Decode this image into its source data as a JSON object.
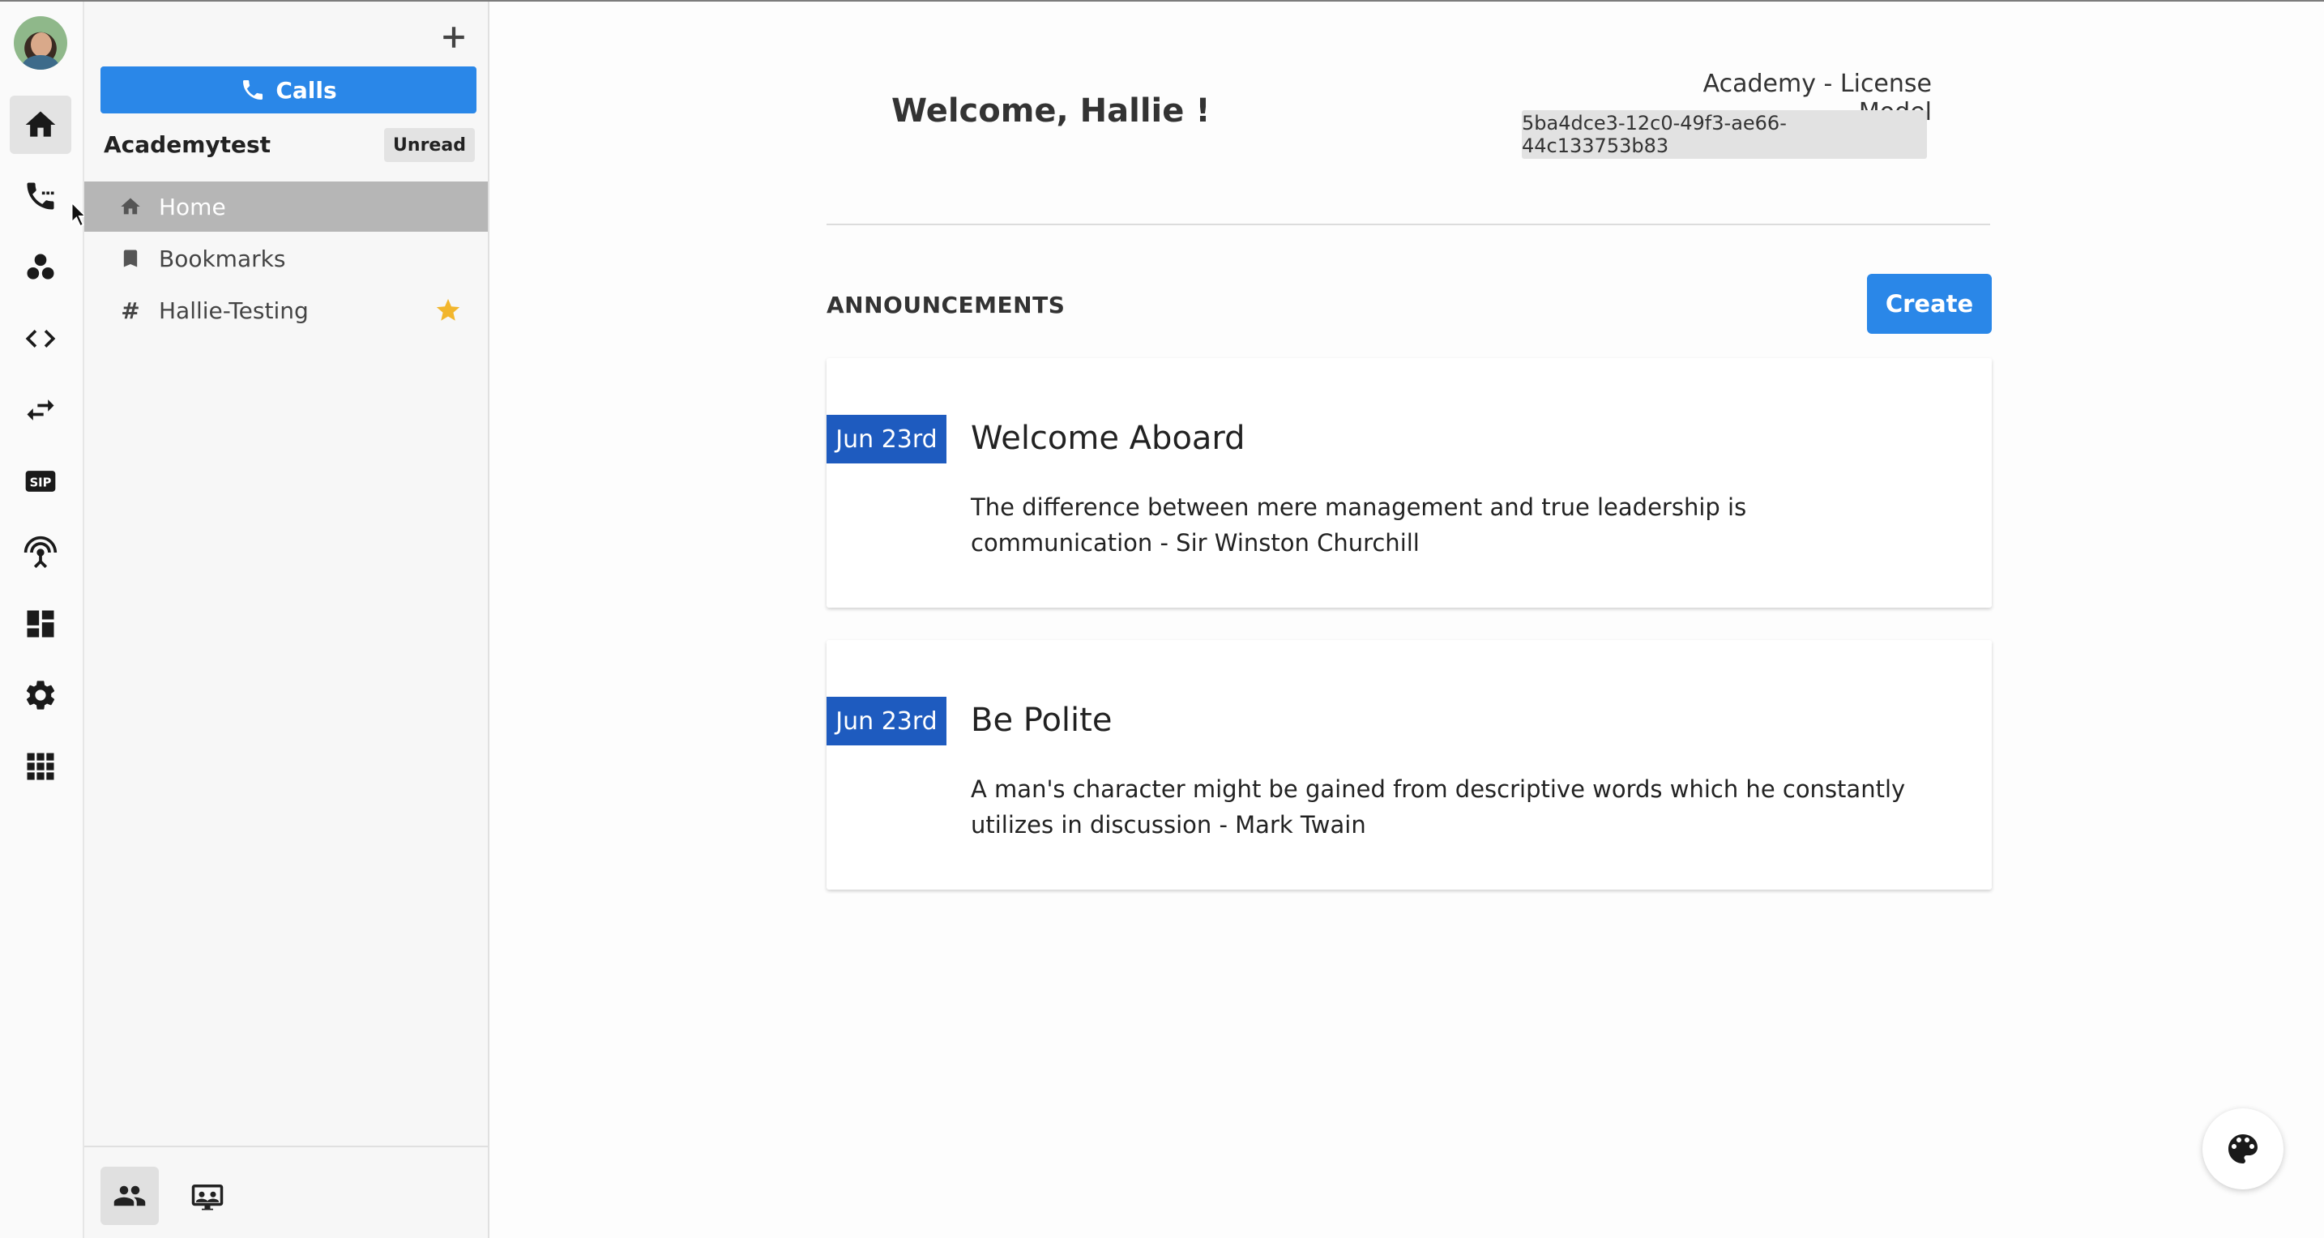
{
  "sidebar": {
    "calls_label": "Calls",
    "team_name": "Academytest",
    "unread_label": "Unread",
    "items": [
      {
        "label": "Home",
        "icon": "home-icon",
        "active": true
      },
      {
        "label": "Bookmarks",
        "icon": "bookmark-icon",
        "active": false
      },
      {
        "label": "Hallie-Testing",
        "icon": "hash-icon",
        "active": false,
        "starred": true
      }
    ],
    "hash_symbol": "#"
  },
  "rail": {
    "items": [
      "home-icon",
      "phone-icon",
      "groups-icon",
      "code-icon",
      "swap-icon",
      "sip-icon",
      "broadcast-icon",
      "dashboard-icon",
      "settings-icon",
      "apps-grid-icon"
    ],
    "active": "home-icon",
    "sip_label": "SIP"
  },
  "header": {
    "welcome": "Welcome, Hallie !",
    "license_title": "Academy - License Model",
    "license_id": "5ba4dce3-12c0-49f3-ae66-44c133753b83"
  },
  "announcements": {
    "heading": "ANNOUNCEMENTS",
    "create_label": "Create",
    "items": [
      {
        "date": "Jun 23rd",
        "title": "Welcome Aboard",
        "body": "The difference between mere management and true leadership is communication - Sir Winston Churchill"
      },
      {
        "date": "Jun 23rd",
        "title": "Be Polite",
        "body": "A man's character might be gained from descriptive words which he constantly utilizes in discussion - Mark Twain"
      }
    ]
  },
  "colors": {
    "primary": "#2a87e8",
    "date_badge": "#1e5bbf",
    "active_nav": "#b6b6b6",
    "star": "#f2b62d"
  }
}
